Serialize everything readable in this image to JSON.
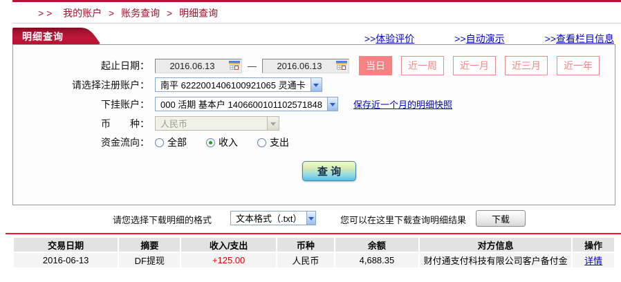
{
  "colors": {
    "accent_red": "#b41336",
    "salmon": "#f58585",
    "link_blue": "#0000cc",
    "amount_red": "#d40000"
  },
  "breadcrumb": {
    "prefix": "> >",
    "sep": ">",
    "items": [
      "我的账户",
      "账务查询",
      "明细查询"
    ]
  },
  "header": {
    "title": "明细查询",
    "link_prefix": ">>",
    "links": [
      "体验评价",
      "自动演示",
      "查看栏目信息"
    ]
  },
  "form": {
    "date_label": "起止日期：",
    "date_from": "2016.06.13",
    "date_to": "2016.06.13",
    "date_separator": "—",
    "quick_buttons": [
      {
        "label": "当日",
        "active": true
      },
      {
        "label": "近一周",
        "active": false
      },
      {
        "label": "近一月",
        "active": false
      },
      {
        "label": "近三月",
        "active": false
      },
      {
        "label": "近一年",
        "active": false
      }
    ],
    "account_label": "请选择注册账户：",
    "account_value": "南平  6222001406100921065  灵通卡",
    "sub_account_label": "下挂账户：",
    "sub_account_value": "000  活期  基本户  1406600101102571848",
    "snapshot_link": "保存近一个月的明细快照",
    "currency_label": "币　　种：",
    "currency_value": "人民币",
    "flow_label": "资金流向：",
    "flow_options": [
      {
        "label": "全部",
        "checked": false
      },
      {
        "label": "收入",
        "checked": true
      },
      {
        "label": "支出",
        "checked": false
      }
    ],
    "query_button": "查 询"
  },
  "download": {
    "format_label": "请您选择下载明细的格式",
    "format_value": "文本格式（.txt）",
    "hint": "您可以在这里下载查询明细结果",
    "button_label": "下载"
  },
  "table": {
    "headers": [
      "交易日期",
      "摘要",
      "收入/支出",
      "币种",
      "余额",
      "对方信息",
      "操作"
    ],
    "rows": [
      {
        "cells": [
          "2016-06-13",
          "DF提现",
          "+125.00",
          "人民币",
          "4,688.35",
          "财付通支付科技有限公司客户备付金",
          "详情"
        ]
      }
    ]
  }
}
